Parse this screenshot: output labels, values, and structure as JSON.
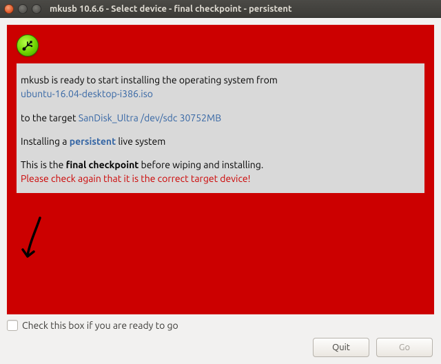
{
  "window": {
    "title": "mkusb 10.6.6 - Select device - final checkpoint - persistent"
  },
  "icon": {
    "usb": "usb"
  },
  "message": {
    "line1_prefix": "mkusb is ready to start installing the operating system from",
    "iso": "ubuntu-16.04-desktop-i386.iso",
    "line2_prefix": "to the target ",
    "target": "SanDisk_Ultra /dev/sdc 30752MB",
    "line3_pre": "Installing a ",
    "line3_bold": "persistent",
    "line3_post": " live system",
    "line4_pre": "This is the ",
    "line4_bold": "final checkpoint",
    "line4_post": " before wiping and installing.",
    "warning": "Please check again that it is the correct target device!"
  },
  "controls": {
    "checkbox_label": "Check this box if you are ready to go",
    "quit": "Quit",
    "go": "Go"
  },
  "colors": {
    "panel_red": "#cc0000",
    "link_blue": "#3465a4",
    "warn_red": "#cc0000"
  }
}
